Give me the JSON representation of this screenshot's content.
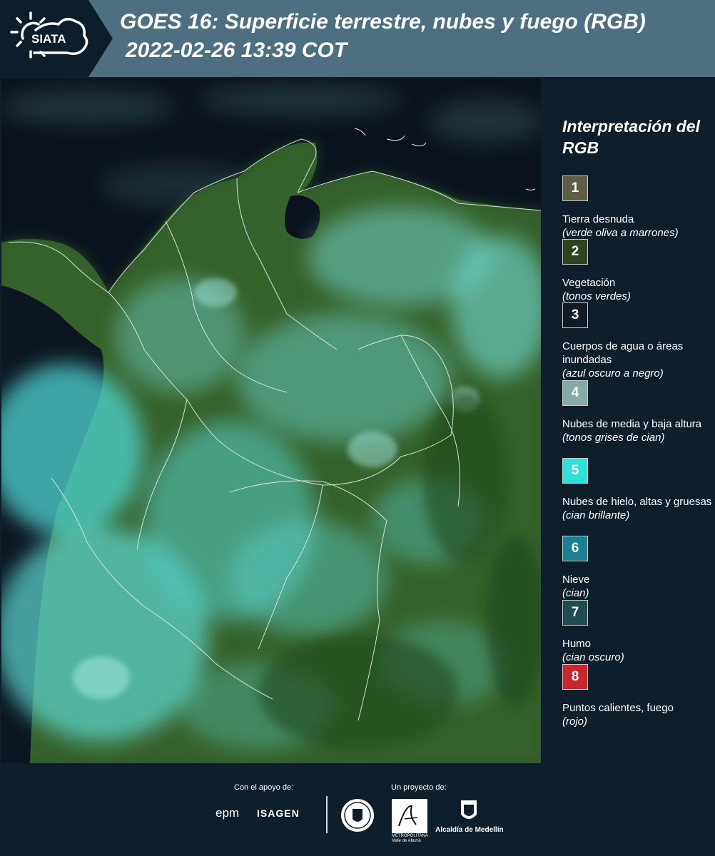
{
  "header": {
    "logo_text": "SIATA",
    "title_line1": "GOES 16: Superficie terrestre, nubes y fuego (RGB)",
    "title_line2": "2022-02-26 13:39 COT"
  },
  "legend": {
    "title": "Interpretación del RGB",
    "items": [
      {
        "number": "1",
        "color": "#5d5e45",
        "name": "Tierra desnuda",
        "description": "(verde oliva a marrones)"
      },
      {
        "number": "2",
        "color": "#2e4421",
        "name": "Vegetación",
        "description": "(tonos verdes)"
      },
      {
        "number": "3",
        "color": "#111b24",
        "name": "Cuerpos de agua o áreas inundadas",
        "description": "(azul oscuro a negro)"
      },
      {
        "number": "4",
        "color": "#86aaa6",
        "name": "Nubes de media y baja altura",
        "description": "(tonos grises de cian)"
      },
      {
        "number": "5",
        "color": "#2fe0d9",
        "name": "Nubes de hielo, altas y gruesas",
        "description": "(cian brillante)"
      },
      {
        "number": "6",
        "color": "#1b8091",
        "name": "Nieve",
        "description": "(cian)"
      },
      {
        "number": "7",
        "color": "#1f4c4f",
        "name": "Humo",
        "description": "(cian oscuro)"
      },
      {
        "number": "8",
        "color": "#c8282b",
        "name": "Puntos calientes, fuego",
        "description": "(rojo)"
      }
    ]
  },
  "footer": {
    "support_label": "Con el apoyo de:",
    "project_label": "Un proyecto de:",
    "epm": "epm",
    "isagen": "ISAGEN",
    "area_text": "METROPOLITANA Valle de Aburrá",
    "medellin": "Alcaldía de Medellín"
  },
  "icons": {
    "logo": "sun-cloud-icon",
    "seal": "seal-icon",
    "area": "area-logo-icon",
    "shield": "shield-icon"
  }
}
